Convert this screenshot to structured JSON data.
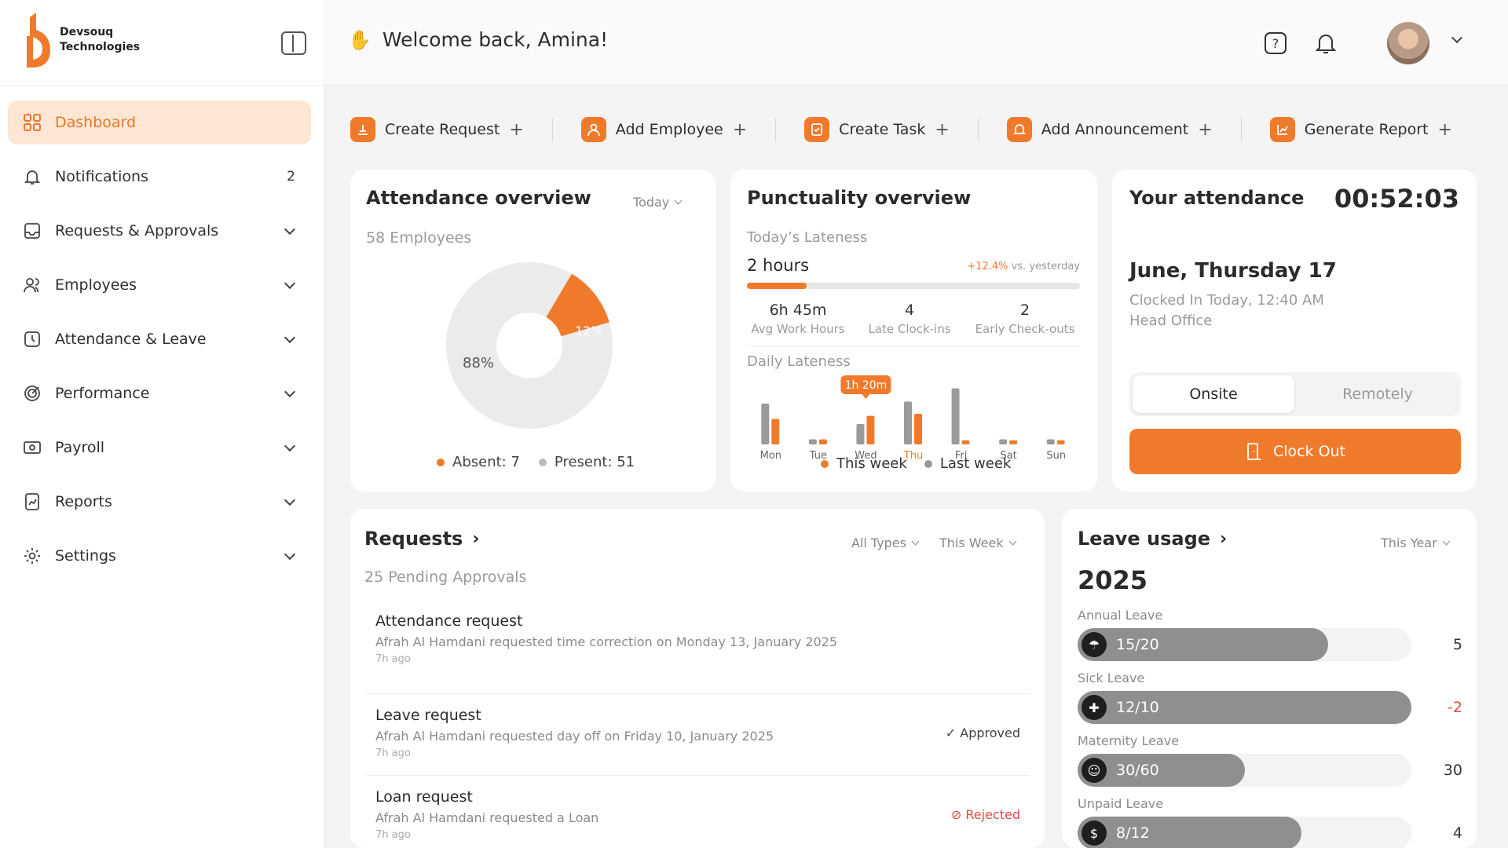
{
  "brand": {
    "line1": "Devsouq",
    "line2": "Technologies",
    "accent": "#f07a2b"
  },
  "sidebar": {
    "items": [
      {
        "label": "Dashboard",
        "icon": "dashboard-grid-icon",
        "active": true
      },
      {
        "label": "Notifications",
        "icon": "bell-icon",
        "count": "2"
      },
      {
        "label": "Requests & Approvals",
        "icon": "inbox-icon"
      },
      {
        "label": "Employees",
        "icon": "users-icon"
      },
      {
        "label": "Attendance & Leave",
        "icon": "clock-icon"
      },
      {
        "label": "Performance",
        "icon": "target-icon"
      },
      {
        "label": "Payroll",
        "icon": "money-icon"
      },
      {
        "label": "Reports",
        "icon": "report-icon"
      },
      {
        "label": "Settings",
        "icon": "gear-icon"
      }
    ]
  },
  "header": {
    "greeting": "Welcome back, Amina!"
  },
  "quick_actions": [
    {
      "label": "Create Request",
      "icon": "request-icon"
    },
    {
      "label": "Add Employee",
      "icon": "user-add-icon"
    },
    {
      "label": "Create Task",
      "icon": "task-icon"
    },
    {
      "label": "Add Announcement",
      "icon": "megaphone-icon"
    },
    {
      "label": "Generate Report",
      "icon": "chart-icon"
    }
  ],
  "attendance_overview": {
    "title": "Attendance overview",
    "period": "Today",
    "employees": "58 Employees",
    "present_pct_label": "88%",
    "absent_pct_label": "12%",
    "legend_absent": "Absent: 7",
    "legend_present": "Present: 51",
    "absent_fraction": 0.12
  },
  "punctuality": {
    "title": "Punctuality overview",
    "lateness_label": "Today’s Lateness",
    "lateness_value": "2 hours",
    "change": "+12.4%",
    "change_suffix": "vs. yesterday",
    "lateness_progress": 0.18,
    "stats": [
      {
        "value": "6h 45m",
        "label": "Avg Work Hours"
      },
      {
        "value": "4",
        "label": "Late Clock-ins"
      },
      {
        "value": "2",
        "label": "Early Check-outs"
      }
    ],
    "daily_title": "Daily Lateness",
    "tooltip": "1h 20m",
    "legend_this": "This week",
    "legend_last": "Last week",
    "highlight_day": "Thu"
  },
  "chart_data": {
    "type": "bar",
    "categories": [
      "Mon",
      "Tue",
      "Wed",
      "Thu",
      "Fri",
      "Sat",
      "Sun"
    ],
    "series": [
      {
        "name": "Last week",
        "values": [
          40,
          5,
          20,
          42,
          55,
          5,
          5
        ]
      },
      {
        "name": "This week",
        "values": [
          25,
          5,
          28,
          30,
          4,
          4,
          4
        ]
      }
    ],
    "ylim": [
      0,
      60
    ]
  },
  "your_attendance": {
    "title": "Your attendance",
    "timer": "00:52:03",
    "date": "June, Thursday 17",
    "clocked_in": "Clocked In Today, 12:40 AM",
    "location": "Head Office",
    "tab_onsite": "Onsite",
    "tab_remote": "Remotely",
    "clock_out": "Clock Out"
  },
  "requests": {
    "title": "Requests",
    "filter_type": "All Types",
    "filter_period": "This Week",
    "pending": "25 Pending Approvals",
    "items": [
      {
        "title": "Attendance request",
        "desc": "Afrah Al Hamdani requested time correction on Monday 13, January 2025",
        "time": "7h ago",
        "status": ""
      },
      {
        "title": "Leave request",
        "desc": "Afrah Al Hamdani requested day off on Friday 10, January 2025",
        "time": "7h ago",
        "status": "Approved"
      },
      {
        "title": "Loan request",
        "desc": "Afrah Al Hamdani requested a Loan",
        "time": "7h ago",
        "status": "Rejected"
      }
    ]
  },
  "leave_usage": {
    "title": "Leave usage",
    "period": "This Year",
    "year": "2025",
    "items": [
      {
        "label": "Annual Leave",
        "frac": "15/20",
        "remaining": "5",
        "progress": 0.75,
        "icon": "beach-icon"
      },
      {
        "label": "Sick Leave",
        "frac": "12/10",
        "remaining": "-2",
        "progress": 1.0,
        "icon": "medical-icon"
      },
      {
        "label": "Maternity Leave",
        "frac": "30/60",
        "remaining": "30",
        "progress": 0.5,
        "icon": "baby-icon"
      },
      {
        "label": "Unpaid Leave",
        "frac": "8/12",
        "remaining": "4",
        "progress": 0.67,
        "icon": "dollar-icon"
      }
    ]
  }
}
